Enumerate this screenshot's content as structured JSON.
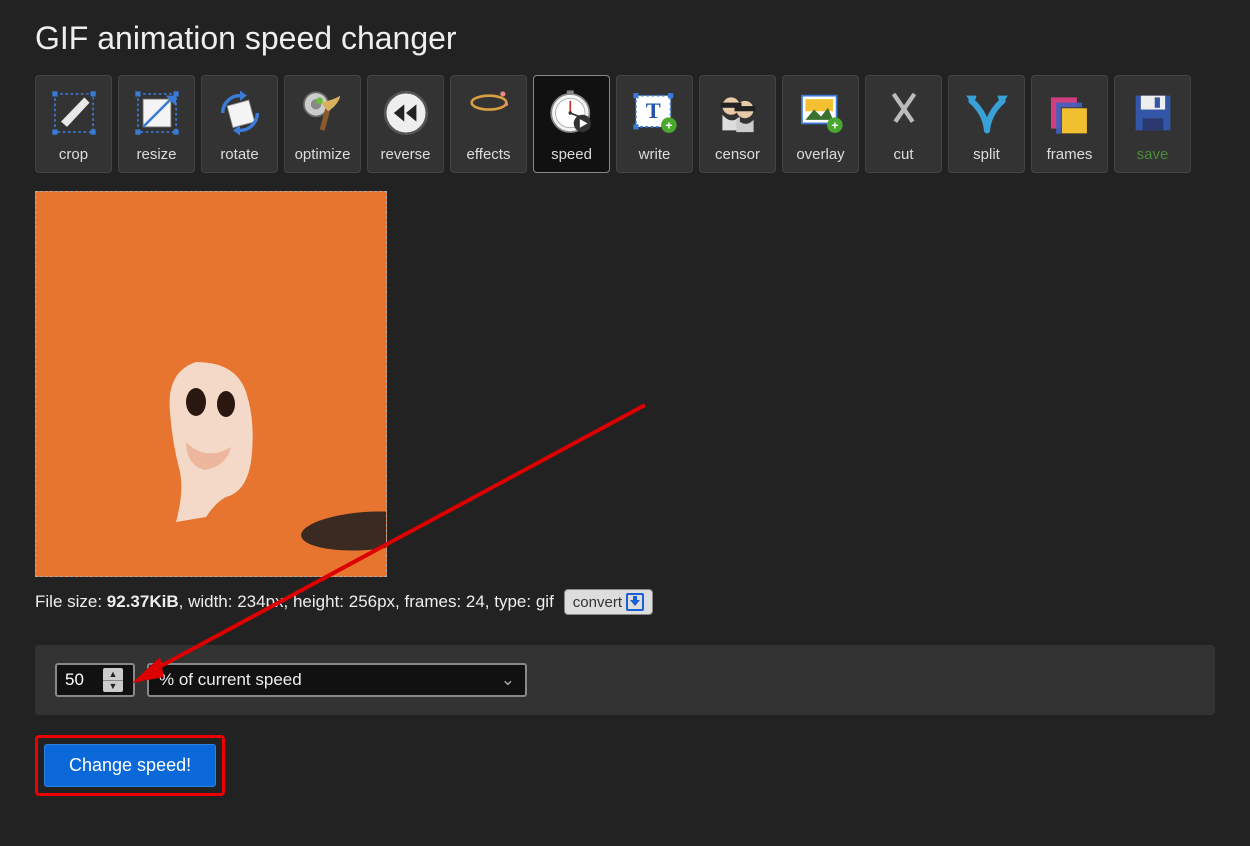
{
  "page_title": "GIF animation speed changer",
  "toolbar": [
    {
      "id": "crop",
      "label": "crop"
    },
    {
      "id": "resize",
      "label": "resize"
    },
    {
      "id": "rotate",
      "label": "rotate"
    },
    {
      "id": "optimize",
      "label": "optimize"
    },
    {
      "id": "reverse",
      "label": "reverse"
    },
    {
      "id": "effects",
      "label": "effects"
    },
    {
      "id": "speed",
      "label": "speed",
      "selected": true
    },
    {
      "id": "write",
      "label": "write"
    },
    {
      "id": "censor",
      "label": "censor"
    },
    {
      "id": "overlay",
      "label": "overlay"
    },
    {
      "id": "cut",
      "label": "cut"
    },
    {
      "id": "split",
      "label": "split"
    },
    {
      "id": "frames",
      "label": "frames"
    },
    {
      "id": "save",
      "label": "save"
    }
  ],
  "file_info": {
    "prefix": "File size: ",
    "size": "92.37KiB",
    "rest": ", width: 234px, height: 256px, frames: 24, type: gif"
  },
  "convert_label": "convert",
  "speed_form": {
    "value": "50",
    "unit_selected": "% of current speed"
  },
  "submit_label": "Change speed!"
}
